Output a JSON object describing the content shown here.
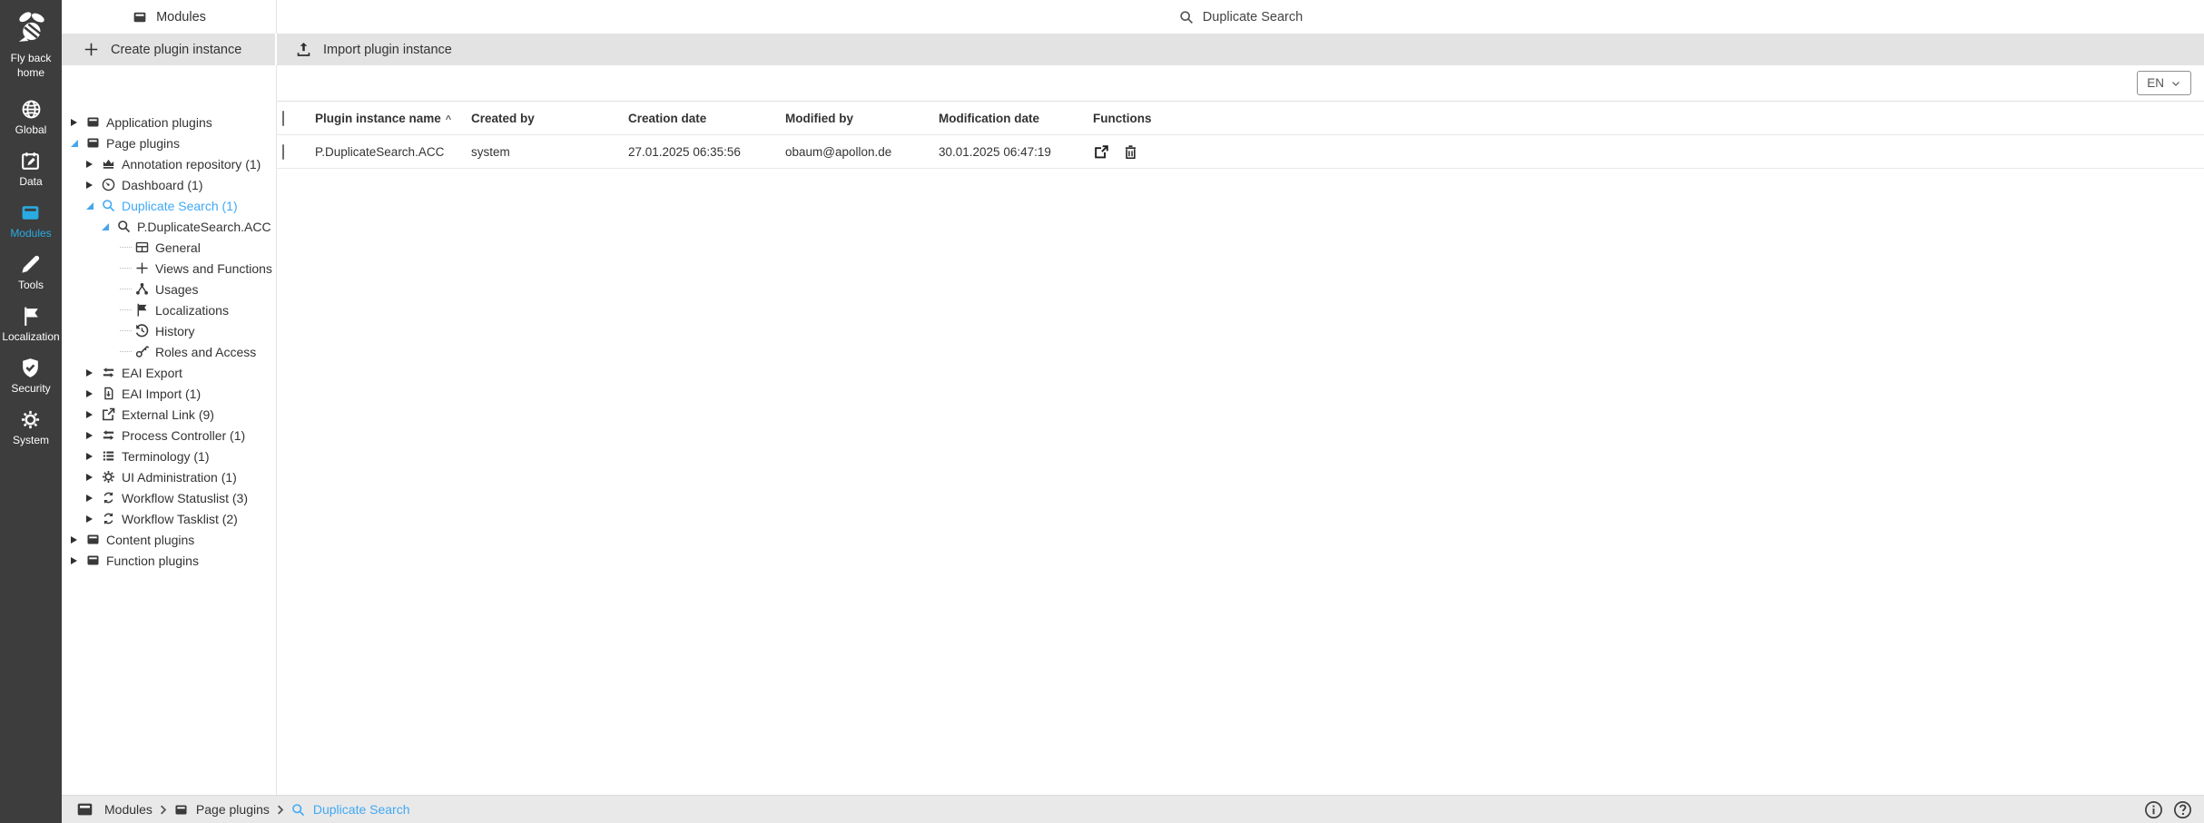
{
  "sidebar": {
    "logo_label": "Fly back home",
    "logo_icon": "bee-icon",
    "items": [
      {
        "label": "Global",
        "icon": "globe-icon",
        "active": false
      },
      {
        "label": "Data",
        "icon": "calendar-pencil-icon",
        "active": false
      },
      {
        "label": "Modules",
        "icon": "modules-box-icon",
        "active": true
      },
      {
        "label": "Tools",
        "icon": "pencil-icon",
        "active": false
      },
      {
        "label": "Localization",
        "icon": "flag-icon",
        "active": false
      },
      {
        "label": "Security",
        "icon": "shield-check-icon",
        "active": false
      },
      {
        "label": "System",
        "icon": "gear-icon",
        "active": false
      }
    ],
    "active_color": "#29abe2"
  },
  "header": {
    "module_title": "Modules",
    "search_label": "Duplicate Search",
    "search_icon": "search-icon"
  },
  "toolbar": {
    "create_label": "Create plugin instance",
    "create_icon": "plus-icon",
    "import_label": "Import plugin instance",
    "import_icon": "upload-icon"
  },
  "language_selector": {
    "value": "EN",
    "icon": "chevron-down-icon"
  },
  "tree": {
    "selection_color": "#3fa9f5",
    "items": [
      {
        "label": "Application plugins",
        "icon": "folder-icon",
        "state": "collapsed",
        "level": 0
      },
      {
        "label": "Page plugins",
        "icon": "folder-icon",
        "state": "expanded",
        "level": 0
      },
      {
        "label": "Annotation repository (1)",
        "icon": "crown-icon",
        "state": "collapsed",
        "level": 1
      },
      {
        "label": "Dashboard (1)",
        "icon": "gauge-icon",
        "state": "collapsed",
        "level": 1
      },
      {
        "label": "Duplicate Search (1)",
        "icon": "search-icon",
        "state": "expanded",
        "level": 1,
        "selected": true
      },
      {
        "label": "P.DuplicateSearch.ACC",
        "icon": "search-icon",
        "state": "expanded",
        "level": 2
      },
      {
        "label": "General",
        "icon": "card-icon",
        "state": "leaf",
        "level": 3
      },
      {
        "label": "Views and Functions",
        "icon": "plus-icon",
        "state": "leaf",
        "level": 3
      },
      {
        "label": "Usages",
        "icon": "network-icon",
        "state": "leaf",
        "level": 3
      },
      {
        "label": "Localizations",
        "icon": "flag-icon",
        "state": "leaf",
        "level": 3
      },
      {
        "label": "History",
        "icon": "history-icon",
        "state": "leaf",
        "level": 3
      },
      {
        "label": "Roles and Access",
        "icon": "key-icon",
        "state": "leaf",
        "level": 3
      },
      {
        "label": "EAI Export",
        "icon": "transfer-icon",
        "state": "collapsed",
        "level": 1
      },
      {
        "label": "EAI Import (1)",
        "icon": "file-import-icon",
        "state": "collapsed",
        "level": 1
      },
      {
        "label": "External Link (9)",
        "icon": "external-link-icon",
        "state": "collapsed",
        "level": 1
      },
      {
        "label": "Process Controller (1)",
        "icon": "transfer-icon",
        "state": "collapsed",
        "level": 1
      },
      {
        "label": "Terminology (1)",
        "icon": "list-icon",
        "state": "collapsed",
        "level": 1
      },
      {
        "label": "UI Administration (1)",
        "icon": "gear-icon",
        "state": "collapsed",
        "level": 1
      },
      {
        "label": "Workflow Statuslist (3)",
        "icon": "workflow-icon",
        "state": "collapsed",
        "level": 1
      },
      {
        "label": "Workflow Tasklist (2)",
        "icon": "workflow-icon",
        "state": "collapsed",
        "level": 1
      },
      {
        "label": "Content plugins",
        "icon": "folder-icon",
        "state": "collapsed",
        "level": 0
      },
      {
        "label": "Function plugins",
        "icon": "folder-icon",
        "state": "collapsed",
        "level": 0
      }
    ]
  },
  "table": {
    "sort_indicator": "^",
    "headers": {
      "name": "Plugin instance name",
      "created_by": "Created by",
      "creation_date": "Creation date",
      "modified_by": "Modified by",
      "modification_date": "Modification date",
      "functions": "Functions"
    },
    "rows": [
      {
        "name": "P.DuplicateSearch.ACC",
        "created_by": "system",
        "creation_date": "27.01.2025 06:35:56",
        "modified_by": "obaum@apollon.de",
        "modification_date": "30.01.2025 06:47:19",
        "function_icons": [
          "export-icon",
          "trash-icon"
        ]
      }
    ]
  },
  "breadcrumb": {
    "items": [
      {
        "label": "Modules",
        "icon": "folder-icon"
      },
      {
        "label": "Page plugins",
        "icon": "folder-icon"
      },
      {
        "label": "Duplicate Search",
        "icon": "search-icon",
        "current": true
      }
    ]
  },
  "statusbar_icons": [
    "info-icon",
    "question-icon"
  ],
  "colors": {
    "sidebar_bg": "#3d3d3d",
    "accent": "#29abe2",
    "selection": "#3fa9f5",
    "toolbar_bg": "#e3e3e3",
    "statusbar_bg": "#e9e9e9"
  }
}
